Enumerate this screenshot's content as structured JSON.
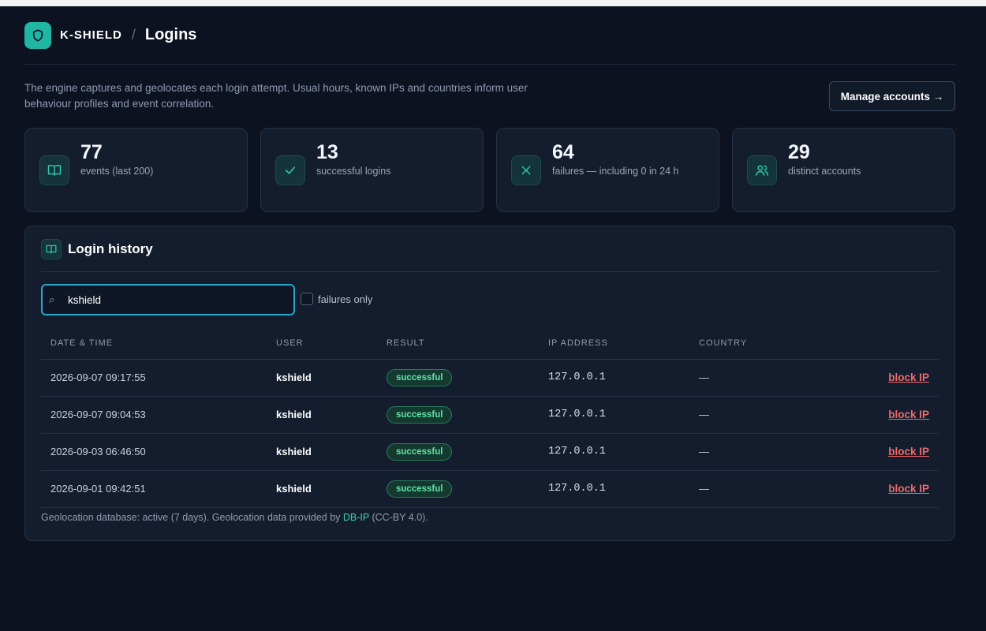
{
  "header": {
    "brand": "K-SHIELD",
    "separator": "/",
    "title": "Logins"
  },
  "intro": {
    "text": "The engine captures and geolocates each login attempt. Usual hours, known IPs and countries inform user behaviour profiles and event correlation.",
    "manage_button": "Manage accounts →"
  },
  "stats": [
    {
      "icon": "book-icon",
      "value": "77",
      "label": "events (last 200)"
    },
    {
      "icon": "check-icon",
      "value": "13",
      "label": "successful logins"
    },
    {
      "icon": "x-icon",
      "value": "64",
      "label": "failures — including 0 in 24 h"
    },
    {
      "icon": "users-icon",
      "value": "29",
      "label": "distinct accounts"
    }
  ],
  "panel": {
    "title": "Login history",
    "search_value": "kshield",
    "failures_only_label": "failures only",
    "failures_only_checked": false,
    "columns": [
      "DATE & TIME",
      "USER",
      "RESULT",
      "IP ADDRESS",
      "COUNTRY"
    ],
    "rows": [
      {
        "datetime": "2026-09-07 09:17:55",
        "user": "kshield",
        "result": "successful",
        "ip": "127.0.0.1",
        "country": "—",
        "action": "block IP"
      },
      {
        "datetime": "2026-09-07 09:04:53",
        "user": "kshield",
        "result": "successful",
        "ip": "127.0.0.1",
        "country": "—",
        "action": "block IP"
      },
      {
        "datetime": "2026-09-03 06:46:50",
        "user": "kshield",
        "result": "successful",
        "ip": "127.0.0.1",
        "country": "—",
        "action": "block IP"
      },
      {
        "datetime": "2026-09-01 09:42:51",
        "user": "kshield",
        "result": "successful",
        "ip": "127.0.0.1",
        "country": "—",
        "action": "block IP"
      }
    ],
    "footnote_prefix": "Geolocation database: active (7 days). Geolocation data provided by ",
    "footnote_link": "DB-IP",
    "footnote_suffix": " (CC-BY 4.0)."
  },
  "colors": {
    "background": "#0c1220",
    "accent": "#1fb6a4",
    "success": "#5fe3a6",
    "danger": "#f06a6a"
  }
}
